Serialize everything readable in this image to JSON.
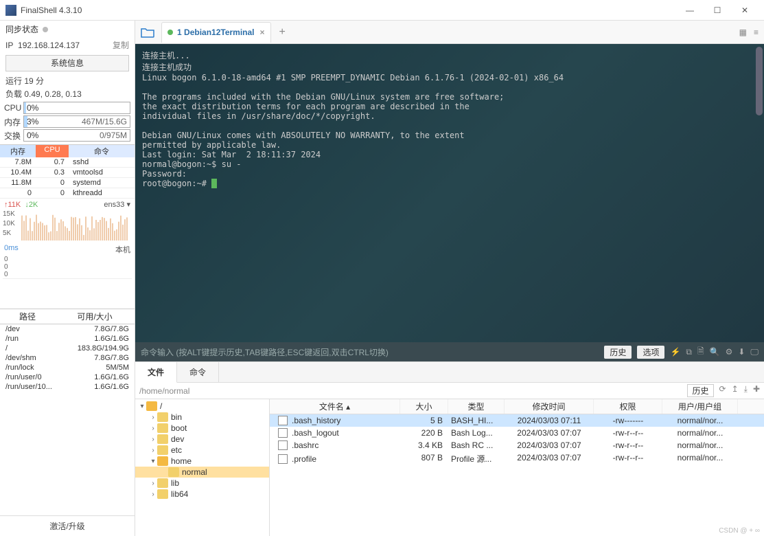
{
  "window": {
    "title": "FinalShell 4.3.10"
  },
  "sidebar": {
    "sync_label": "同步状态",
    "ip_label": "IP",
    "ip": "192.168.124.137",
    "copy": "复制",
    "sysinfo_btn": "系统信息",
    "uptime": "运行 19 分",
    "load": "负载 0.49, 0.28, 0.13",
    "meters": {
      "cpu_label": "CPU",
      "cpu_pct": "0%",
      "cpu_rt": "",
      "mem_label": "内存",
      "mem_pct": "3%",
      "mem_rt": "467M/15.6G",
      "swap_label": "交换",
      "swap_pct": "0%",
      "swap_rt": "0/975M"
    },
    "proc_hdr": {
      "c1": "内存",
      "c2": "CPU",
      "c3": "命令"
    },
    "procs": [
      {
        "mem": "7.8M",
        "cpu": "0.7",
        "cmd": "sshd"
      },
      {
        "mem": "10.4M",
        "cpu": "0.3",
        "cmd": "vmtoolsd"
      },
      {
        "mem": "11.8M",
        "cpu": "0",
        "cmd": "systemd"
      },
      {
        "mem": "0",
        "cpu": "0",
        "cmd": "kthreadd"
      }
    ],
    "net": {
      "up": "↑11K",
      "down": "↓2K",
      "iface": "ens33",
      "dd": "▾"
    },
    "spark_ticks": {
      "a": "15K",
      "b": "10K",
      "c": "5K"
    },
    "local": {
      "lat": "0ms",
      "host": "本机"
    },
    "path_hdr": {
      "c1": "路径",
      "c2": "可用/大小"
    },
    "paths": [
      {
        "p": "/dev",
        "s": "7.8G/7.8G"
      },
      {
        "p": "/run",
        "s": "1.6G/1.6G"
      },
      {
        "p": "/",
        "s": "183.8G/194.9G"
      },
      {
        "p": "/dev/shm",
        "s": "7.8G/7.8G"
      },
      {
        "p": "/run/lock",
        "s": "5M/5M"
      },
      {
        "p": "/run/user/0",
        "s": "1.6G/1.6G"
      },
      {
        "p": "/run/user/10...",
        "s": "1.6G/1.6G"
      }
    ],
    "activate": "激活/升级"
  },
  "tabs": {
    "t1_num": "1",
    "t1_name": "Debian12Terminal"
  },
  "terminal_text": "连接主机...\n连接主机成功\nLinux bogon 6.1.0-18-amd64 #1 SMP PREEMPT_DYNAMIC Debian 6.1.76-1 (2024-02-01) x86_64\n\nThe programs included with the Debian GNU/Linux system are free software;\nthe exact distribution terms for each program are described in the\nindividual files in /usr/share/doc/*/copyright.\n\nDebian GNU/Linux comes with ABSOLUTELY NO WARRANTY, to the extent\npermitted by applicable law.\nLast login: Sat Mar  2 18:11:37 2024\nnormal@bogon:~$ su -\nPassword:\nroot@bogon:~# ",
  "cmd_bar": {
    "hint": "命令输入 (按ALT键提示历史,TAB键路径,ESC键返回,双击CTRL切换)",
    "b1": "历史",
    "b2": "选项"
  },
  "bottom": {
    "tabs": {
      "t1": "文件",
      "t2": "命令"
    },
    "path": "/home/normal",
    "history": "历史",
    "tree": [
      "/",
      "bin",
      "boot",
      "dev",
      "etc",
      "home",
      "normal",
      "lib",
      "lib64"
    ],
    "fhdr": {
      "c1": "文件名",
      "c2": "大小",
      "c3": "类型",
      "c4": "修改时间",
      "c5": "权限",
      "c6": "用户/用户组"
    },
    "files": [
      {
        "n": ".bash_history",
        "s": "5 B",
        "t": "BASH_HI...",
        "d": "2024/03/03 07:11",
        "p": "-rw-------",
        "u": "normal/nor..."
      },
      {
        "n": ".bash_logout",
        "s": "220 B",
        "t": "Bash Log...",
        "d": "2024/03/03 07:07",
        "p": "-rw-r--r--",
        "u": "normal/nor..."
      },
      {
        "n": ".bashrc",
        "s": "3.4 KB",
        "t": "Bash RC ...",
        "d": "2024/03/03 07:07",
        "p": "-rw-r--r--",
        "u": "normal/nor..."
      },
      {
        "n": ".profile",
        "s": "807 B",
        "t": "Profile 源...",
        "d": "2024/03/03 07:07",
        "p": "-rw-r--r--",
        "u": "normal/nor..."
      }
    ]
  },
  "watermark": "CSDN @ + ∞"
}
